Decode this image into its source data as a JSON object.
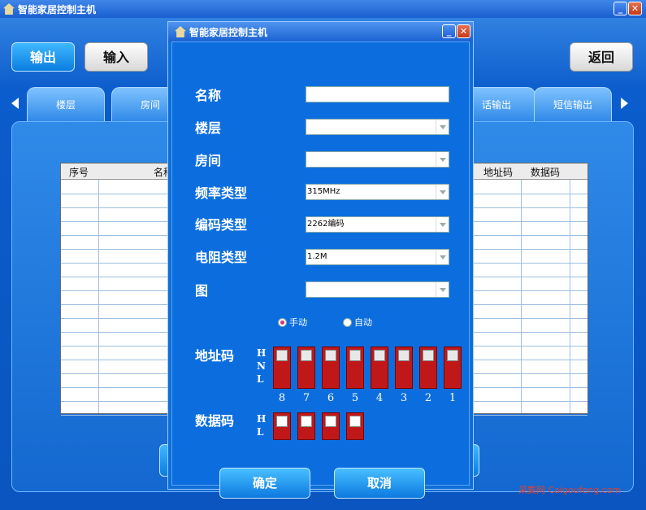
{
  "main": {
    "title": "智能家居控制主机",
    "output_btn": "输出",
    "input_btn": "输入",
    "back_btn": "返回",
    "tabs": [
      "楼层",
      "房间",
      "电话输出",
      "短信输出"
    ],
    "tab_partial": [
      "楼层",
      "房间",
      "话输出",
      "短信输出"
    ],
    "grid_headers": [
      "序号",
      "名称",
      "地址码",
      "数据码"
    ],
    "watermark": "采集网 Caigoufeng.com",
    "min_icon": "minimize-icon",
    "close_icon": "close-icon"
  },
  "dialog": {
    "title": "智能家居控制主机",
    "name_label": "名称",
    "floor_label": "楼层",
    "room_label": "房间",
    "freq_label": "频率类型",
    "freq_value": "315MHz",
    "code_label": "编码类型",
    "code_value": "2262编码",
    "resist_label": "电阻类型",
    "resist_value": "1.2M",
    "pic_label": "图",
    "manual": "手动",
    "auto": "自动",
    "addr_label": "地址码",
    "data_label": "数据码",
    "hnl": "H\nN\nL",
    "hl": "H\nL",
    "addr_numbers": [
      "8",
      "7",
      "6",
      "5",
      "4",
      "3",
      "2",
      "1"
    ],
    "ok": "确定",
    "cancel": "取消"
  },
  "colors": {
    "accent": "#0a7de0",
    "dip_red": "#c01818"
  }
}
